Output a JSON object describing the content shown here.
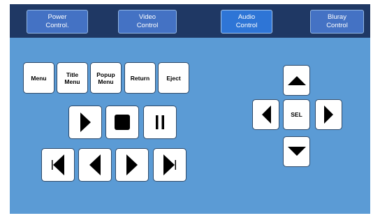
{
  "tabs": [
    {
      "label": "Power\nControl.",
      "active": false
    },
    {
      "label": "Video\nControl",
      "active": false
    },
    {
      "label": "Audio\nControl",
      "active": true
    },
    {
      "label": "Bluray\nControl",
      "active": false
    }
  ],
  "menu_buttons": [
    "Menu",
    "Title\nMenu",
    "Popup\nMenu",
    "Return",
    "Eject"
  ],
  "transport": {
    "play_icon": "play-icon",
    "stop_icon": "stop-icon",
    "pause_icon": "pause-icon",
    "skip_back_icon": "skip-previous-icon",
    "rewind_icon": "rewind-icon",
    "forward_icon": "fast-forward-icon",
    "skip_forward_icon": "skip-next-icon"
  },
  "dpad": {
    "select_label": "SEL",
    "up_icon": "arrow-up-icon",
    "down_icon": "arrow-down-icon",
    "left_icon": "arrow-left-icon",
    "right_icon": "arrow-right-icon"
  },
  "colors": {
    "background": "#5b9bd5",
    "header": "#1f3864",
    "tab": "#4472c4",
    "tab_active": "#2e75d6"
  }
}
